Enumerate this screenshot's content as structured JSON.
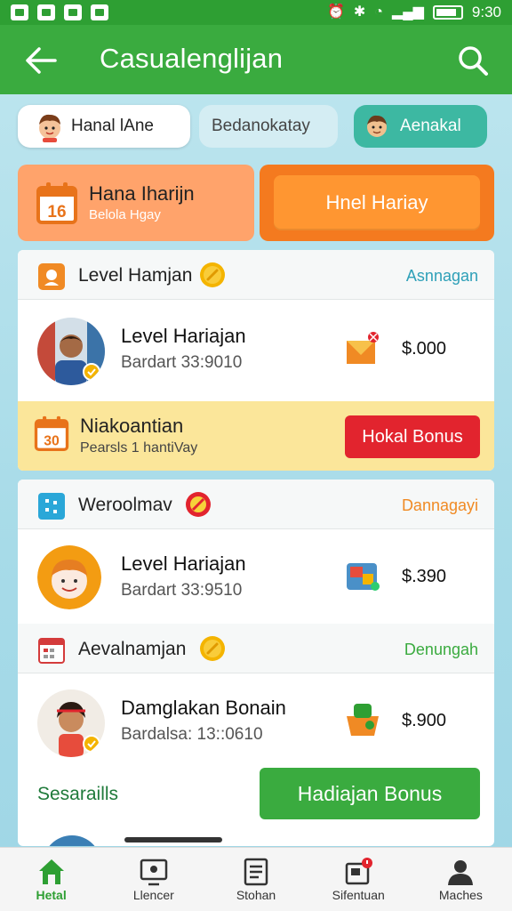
{
  "status_bar": {
    "time": "9:30"
  },
  "app_bar": {
    "title": "Casualenglijan"
  },
  "chips": [
    {
      "label": "Hanal lAne"
    },
    {
      "label": "Bedanokatay"
    },
    {
      "label": "Aenakal"
    }
  ],
  "banner": {
    "calendar_number": "16",
    "title": "Hana Iharijn",
    "subtitle": "Belola Hgay",
    "button_label": "Hnel Hariay"
  },
  "section1": {
    "title": "Level Hamjan",
    "link": "Asnnagan",
    "row": {
      "title": "Level Hariajan",
      "subtitle": "Bardart 33:9010",
      "amount": "$.000"
    },
    "promo": {
      "calendar_number": "30",
      "title": "Niakoantian",
      "subtitle": "Pearsls 1 hantiVay",
      "button_label": "Hokal Bonus"
    }
  },
  "section2": {
    "title": "Weroolmav",
    "link": "Dannagayi",
    "row": {
      "title": "Level Hariajan",
      "subtitle": "Bardart 33:9510",
      "amount": "$.390"
    }
  },
  "section3": {
    "title": "Aevalnamjan",
    "link": "Denungah",
    "row": {
      "title": "Damglakan Bonain",
      "subtitle": "Bardalsa: 13::0610",
      "amount": "$.900"
    }
  },
  "bonus": {
    "label": "Sesaraills",
    "button_label": "Hadiajan Bonus"
  },
  "bottom_nav": [
    {
      "label": "Hetal",
      "icon": "home-icon",
      "active": true
    },
    {
      "label": "Llencer",
      "icon": "monitor-icon",
      "active": false
    },
    {
      "label": "Stohan",
      "icon": "document-icon",
      "active": false
    },
    {
      "label": "Sifentuan",
      "icon": "inbox-icon",
      "active": false
    },
    {
      "label": "Maches",
      "icon": "profile-icon",
      "active": false
    }
  ],
  "colors": {
    "primary_green": "#3aab3f",
    "orange": "#f47a1f",
    "red": "#e2242e",
    "teal": "#3db8a2"
  }
}
